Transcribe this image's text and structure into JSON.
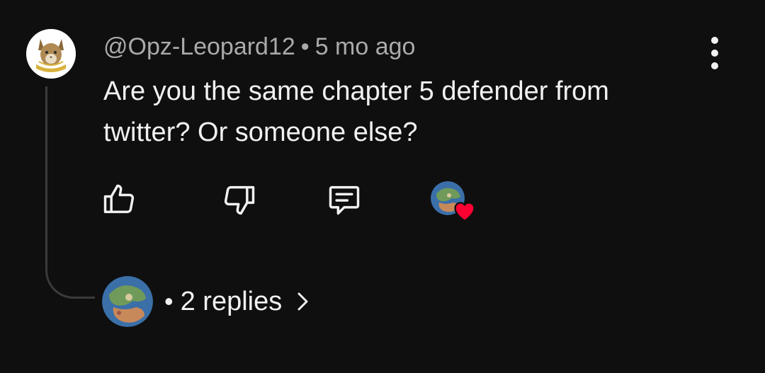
{
  "comment": {
    "author": "@Opz-Leopard12",
    "separator": "•",
    "time": "5 mo ago",
    "text": "Are you the same chapter 5 defender from twitter? Or someone else?"
  },
  "actions": {
    "like_icon": "thumbs-up-icon",
    "dislike_icon": "thumbs-down-icon",
    "reply_icon": "comment-icon",
    "creator_heart_icon": "heart-icon"
  },
  "replies": {
    "separator": "•",
    "label": "2 replies",
    "chevron_icon": "chevron-right-icon"
  },
  "colors": {
    "background": "#0f0f0f",
    "text_primary": "#f1f1f1",
    "text_secondary": "#aaaaaa",
    "heart": "#ff0033",
    "thread_line": "#3a3a3a"
  }
}
